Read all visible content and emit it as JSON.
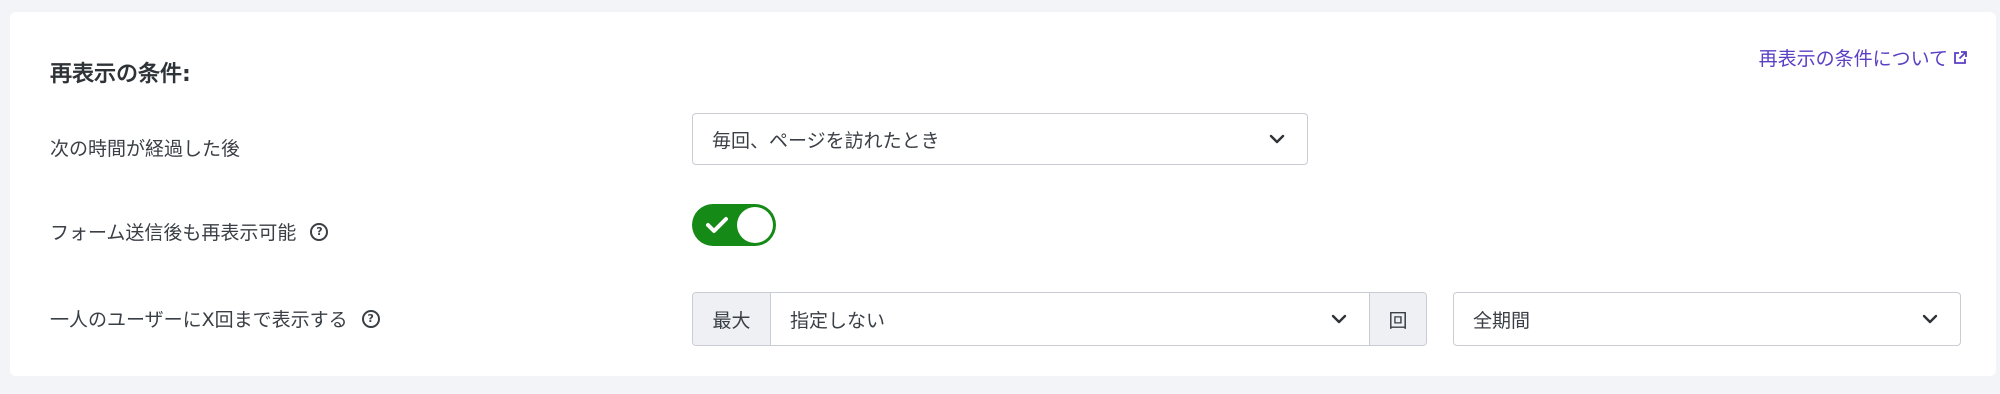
{
  "section": {
    "title": "再表示の条件:",
    "help_link": "再表示の条件について"
  },
  "rows": {
    "elapsed": {
      "label": "次の時間が経過した後",
      "value": "毎回、ページを訪れたとき"
    },
    "after_submit": {
      "label": "フォーム送信後も再表示可能",
      "help_icon": "?",
      "enabled": true,
      "toggle_color": "#168a16"
    },
    "max_per_user": {
      "label": "一人のユーザーにX回まで表示する",
      "help_icon": "?",
      "prefix": "最大",
      "value": "指定しない",
      "suffix": "回",
      "period": "全期間"
    }
  },
  "colors": {
    "accent": "#5b3fc4",
    "toggle_on": "#168a16",
    "addon_bg": "#eef0f4"
  }
}
